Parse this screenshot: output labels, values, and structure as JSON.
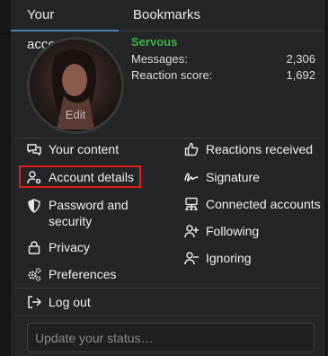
{
  "tabs": [
    {
      "label": "Your account"
    },
    {
      "label": "Bookmarks"
    }
  ],
  "profile": {
    "avatar_edit": "Edit",
    "username": "Servous",
    "username_color": "#3db146",
    "stats": [
      {
        "label": "Messages:",
        "value": "2,306"
      },
      {
        "label": "Reaction score:",
        "value": "1,692"
      }
    ]
  },
  "menu": {
    "left": [
      {
        "label": "Your content",
        "icon": "comments-icon"
      },
      {
        "label": "Account details",
        "icon": "user-cog-icon",
        "highlighted": true
      },
      {
        "label": "Password and security",
        "icon": "shield-icon"
      },
      {
        "label": "Privacy",
        "icon": "lock-icon"
      },
      {
        "label": "Preferences",
        "icon": "cogs-icon"
      }
    ],
    "right": [
      {
        "label": "Reactions received",
        "icon": "thumbs-up-icon"
      },
      {
        "label": "Signature",
        "icon": "signature-icon"
      },
      {
        "label": "Connected accounts",
        "icon": "network-icon"
      },
      {
        "label": "Following",
        "icon": "user-plus-icon"
      },
      {
        "label": "Ignoring",
        "icon": "user-minus-icon"
      }
    ],
    "logout": {
      "label": "Log out",
      "icon": "sign-out-icon"
    }
  },
  "status": {
    "placeholder": "Update your status…",
    "value": ""
  },
  "colors": {
    "highlight_border": "#e01b1b",
    "tab_underline": "#4b7fb8"
  }
}
